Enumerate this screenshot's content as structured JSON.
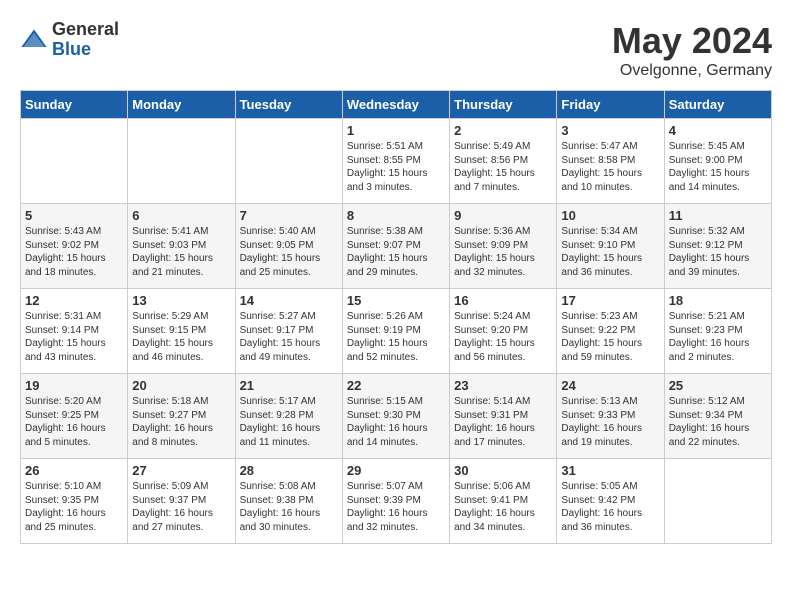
{
  "header": {
    "logo_general": "General",
    "logo_blue": "Blue",
    "title": "May 2024",
    "location": "Ovelgonne, Germany"
  },
  "days_of_week": [
    "Sunday",
    "Monday",
    "Tuesday",
    "Wednesday",
    "Thursday",
    "Friday",
    "Saturday"
  ],
  "weeks": [
    [
      {
        "day": "",
        "info": ""
      },
      {
        "day": "",
        "info": ""
      },
      {
        "day": "",
        "info": ""
      },
      {
        "day": "1",
        "info": "Sunrise: 5:51 AM\nSunset: 8:55 PM\nDaylight: 15 hours\nand 3 minutes."
      },
      {
        "day": "2",
        "info": "Sunrise: 5:49 AM\nSunset: 8:56 PM\nDaylight: 15 hours\nand 7 minutes."
      },
      {
        "day": "3",
        "info": "Sunrise: 5:47 AM\nSunset: 8:58 PM\nDaylight: 15 hours\nand 10 minutes."
      },
      {
        "day": "4",
        "info": "Sunrise: 5:45 AM\nSunset: 9:00 PM\nDaylight: 15 hours\nand 14 minutes."
      }
    ],
    [
      {
        "day": "5",
        "info": "Sunrise: 5:43 AM\nSunset: 9:02 PM\nDaylight: 15 hours\nand 18 minutes."
      },
      {
        "day": "6",
        "info": "Sunrise: 5:41 AM\nSunset: 9:03 PM\nDaylight: 15 hours\nand 21 minutes."
      },
      {
        "day": "7",
        "info": "Sunrise: 5:40 AM\nSunset: 9:05 PM\nDaylight: 15 hours\nand 25 minutes."
      },
      {
        "day": "8",
        "info": "Sunrise: 5:38 AM\nSunset: 9:07 PM\nDaylight: 15 hours\nand 29 minutes."
      },
      {
        "day": "9",
        "info": "Sunrise: 5:36 AM\nSunset: 9:09 PM\nDaylight: 15 hours\nand 32 minutes."
      },
      {
        "day": "10",
        "info": "Sunrise: 5:34 AM\nSunset: 9:10 PM\nDaylight: 15 hours\nand 36 minutes."
      },
      {
        "day": "11",
        "info": "Sunrise: 5:32 AM\nSunset: 9:12 PM\nDaylight: 15 hours\nand 39 minutes."
      }
    ],
    [
      {
        "day": "12",
        "info": "Sunrise: 5:31 AM\nSunset: 9:14 PM\nDaylight: 15 hours\nand 43 minutes."
      },
      {
        "day": "13",
        "info": "Sunrise: 5:29 AM\nSunset: 9:15 PM\nDaylight: 15 hours\nand 46 minutes."
      },
      {
        "day": "14",
        "info": "Sunrise: 5:27 AM\nSunset: 9:17 PM\nDaylight: 15 hours\nand 49 minutes."
      },
      {
        "day": "15",
        "info": "Sunrise: 5:26 AM\nSunset: 9:19 PM\nDaylight: 15 hours\nand 52 minutes."
      },
      {
        "day": "16",
        "info": "Sunrise: 5:24 AM\nSunset: 9:20 PM\nDaylight: 15 hours\nand 56 minutes."
      },
      {
        "day": "17",
        "info": "Sunrise: 5:23 AM\nSunset: 9:22 PM\nDaylight: 15 hours\nand 59 minutes."
      },
      {
        "day": "18",
        "info": "Sunrise: 5:21 AM\nSunset: 9:23 PM\nDaylight: 16 hours\nand 2 minutes."
      }
    ],
    [
      {
        "day": "19",
        "info": "Sunrise: 5:20 AM\nSunset: 9:25 PM\nDaylight: 16 hours\nand 5 minutes."
      },
      {
        "day": "20",
        "info": "Sunrise: 5:18 AM\nSunset: 9:27 PM\nDaylight: 16 hours\nand 8 minutes."
      },
      {
        "day": "21",
        "info": "Sunrise: 5:17 AM\nSunset: 9:28 PM\nDaylight: 16 hours\nand 11 minutes."
      },
      {
        "day": "22",
        "info": "Sunrise: 5:15 AM\nSunset: 9:30 PM\nDaylight: 16 hours\nand 14 minutes."
      },
      {
        "day": "23",
        "info": "Sunrise: 5:14 AM\nSunset: 9:31 PM\nDaylight: 16 hours\nand 17 minutes."
      },
      {
        "day": "24",
        "info": "Sunrise: 5:13 AM\nSunset: 9:33 PM\nDaylight: 16 hours\nand 19 minutes."
      },
      {
        "day": "25",
        "info": "Sunrise: 5:12 AM\nSunset: 9:34 PM\nDaylight: 16 hours\nand 22 minutes."
      }
    ],
    [
      {
        "day": "26",
        "info": "Sunrise: 5:10 AM\nSunset: 9:35 PM\nDaylight: 16 hours\nand 25 minutes."
      },
      {
        "day": "27",
        "info": "Sunrise: 5:09 AM\nSunset: 9:37 PM\nDaylight: 16 hours\nand 27 minutes."
      },
      {
        "day": "28",
        "info": "Sunrise: 5:08 AM\nSunset: 9:38 PM\nDaylight: 16 hours\nand 30 minutes."
      },
      {
        "day": "29",
        "info": "Sunrise: 5:07 AM\nSunset: 9:39 PM\nDaylight: 16 hours\nand 32 minutes."
      },
      {
        "day": "30",
        "info": "Sunrise: 5:06 AM\nSunset: 9:41 PM\nDaylight: 16 hours\nand 34 minutes."
      },
      {
        "day": "31",
        "info": "Sunrise: 5:05 AM\nSunset: 9:42 PM\nDaylight: 16 hours\nand 36 minutes."
      },
      {
        "day": "",
        "info": ""
      }
    ]
  ]
}
